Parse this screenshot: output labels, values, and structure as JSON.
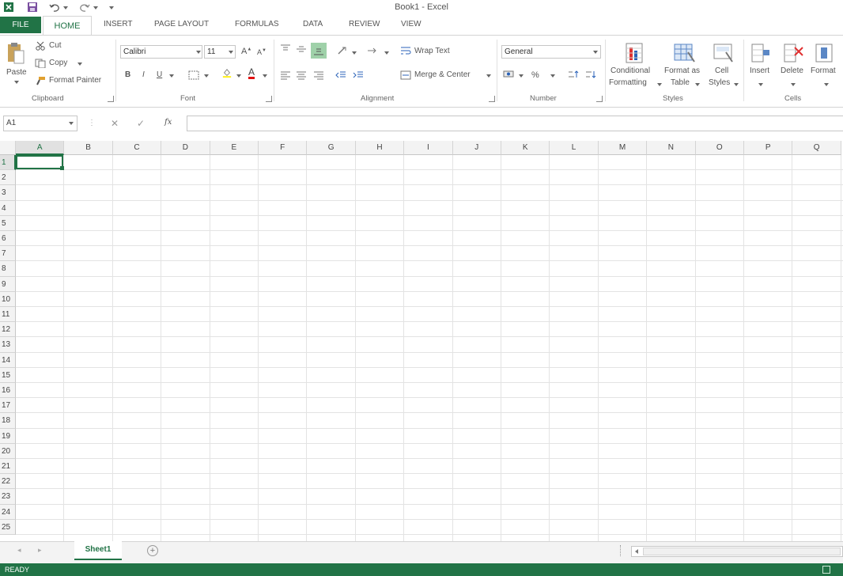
{
  "window": {
    "title": "Book1 - Excel"
  },
  "tabs": [
    "FILE",
    "HOME",
    "INSERT",
    "PAGE LAYOUT",
    "FORMULAS",
    "DATA",
    "REVIEW",
    "VIEW"
  ],
  "ribbon": {
    "clipboard": {
      "paste": "Paste",
      "cut": "Cut",
      "copy": "Copy",
      "format_painter": "Format Painter",
      "label": "Clipboard"
    },
    "font": {
      "name": "Calibri",
      "size": "11",
      "bold": "B",
      "italic": "I",
      "underline": "U",
      "label": "Font"
    },
    "alignment": {
      "wrap_text": "Wrap Text",
      "merge_center": "Merge & Center",
      "label": "Alignment"
    },
    "number": {
      "format": "General",
      "percent": "%",
      "label": "Number"
    },
    "styles": {
      "conditional_1": "Conditional",
      "conditional_2": "Formatting",
      "format_table_1": "Format as",
      "format_table_2": "Table",
      "cell_styles_1": "Cell",
      "cell_styles_2": "Styles",
      "label": "Styles"
    },
    "cells": {
      "insert": "Insert",
      "delete": "Delete",
      "format": "Format",
      "label": "Cells"
    }
  },
  "formula_bar": {
    "name_box": "A1",
    "fx": "fx",
    "value": ""
  },
  "grid": {
    "columns": [
      "A",
      "B",
      "C",
      "D",
      "E",
      "F",
      "G",
      "H",
      "I",
      "J",
      "K",
      "L",
      "M",
      "N",
      "O",
      "P",
      "Q"
    ],
    "rows": [
      "1",
      "2",
      "3",
      "4",
      "5",
      "6",
      "7",
      "8",
      "9",
      "10",
      "11",
      "12",
      "13",
      "14",
      "15",
      "16",
      "17",
      "18",
      "19",
      "20",
      "21",
      "22",
      "23",
      "24",
      "25"
    ],
    "active_cell": "A1"
  },
  "sheets": {
    "tabs": [
      "Sheet1"
    ]
  },
  "status": {
    "text": "READY"
  },
  "colors": {
    "accent": "#217346"
  }
}
